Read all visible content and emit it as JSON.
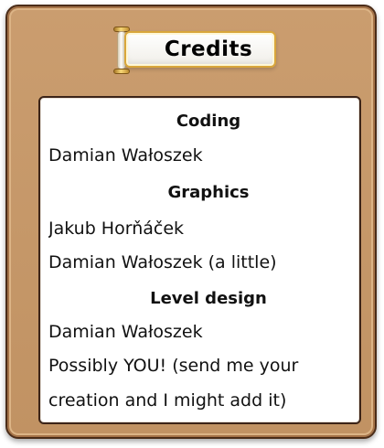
{
  "window": {
    "title": "Credits"
  },
  "credits": {
    "coding_heading": "Coding",
    "coding_names": [
      "Damian Wałoszek"
    ],
    "graphics_heading": "Graphics",
    "graphics_names": [
      "Jakub Horňáček",
      "Damian Wałoszek (a little)"
    ],
    "level_design_heading": "Level design",
    "level_design_names": [
      "Damian Wałoszek",
      "Possibly YOU! (send me your",
      "creation and I might add it)"
    ]
  },
  "colors": {
    "board_wood": "#c79766",
    "board_border": "#4b2c18",
    "panel_background": "#ffffff",
    "plaque_border": "#d9a63b",
    "text": "#111111"
  },
  "icons": {
    "plaque_ornament": "scroll-rod-icon"
  }
}
